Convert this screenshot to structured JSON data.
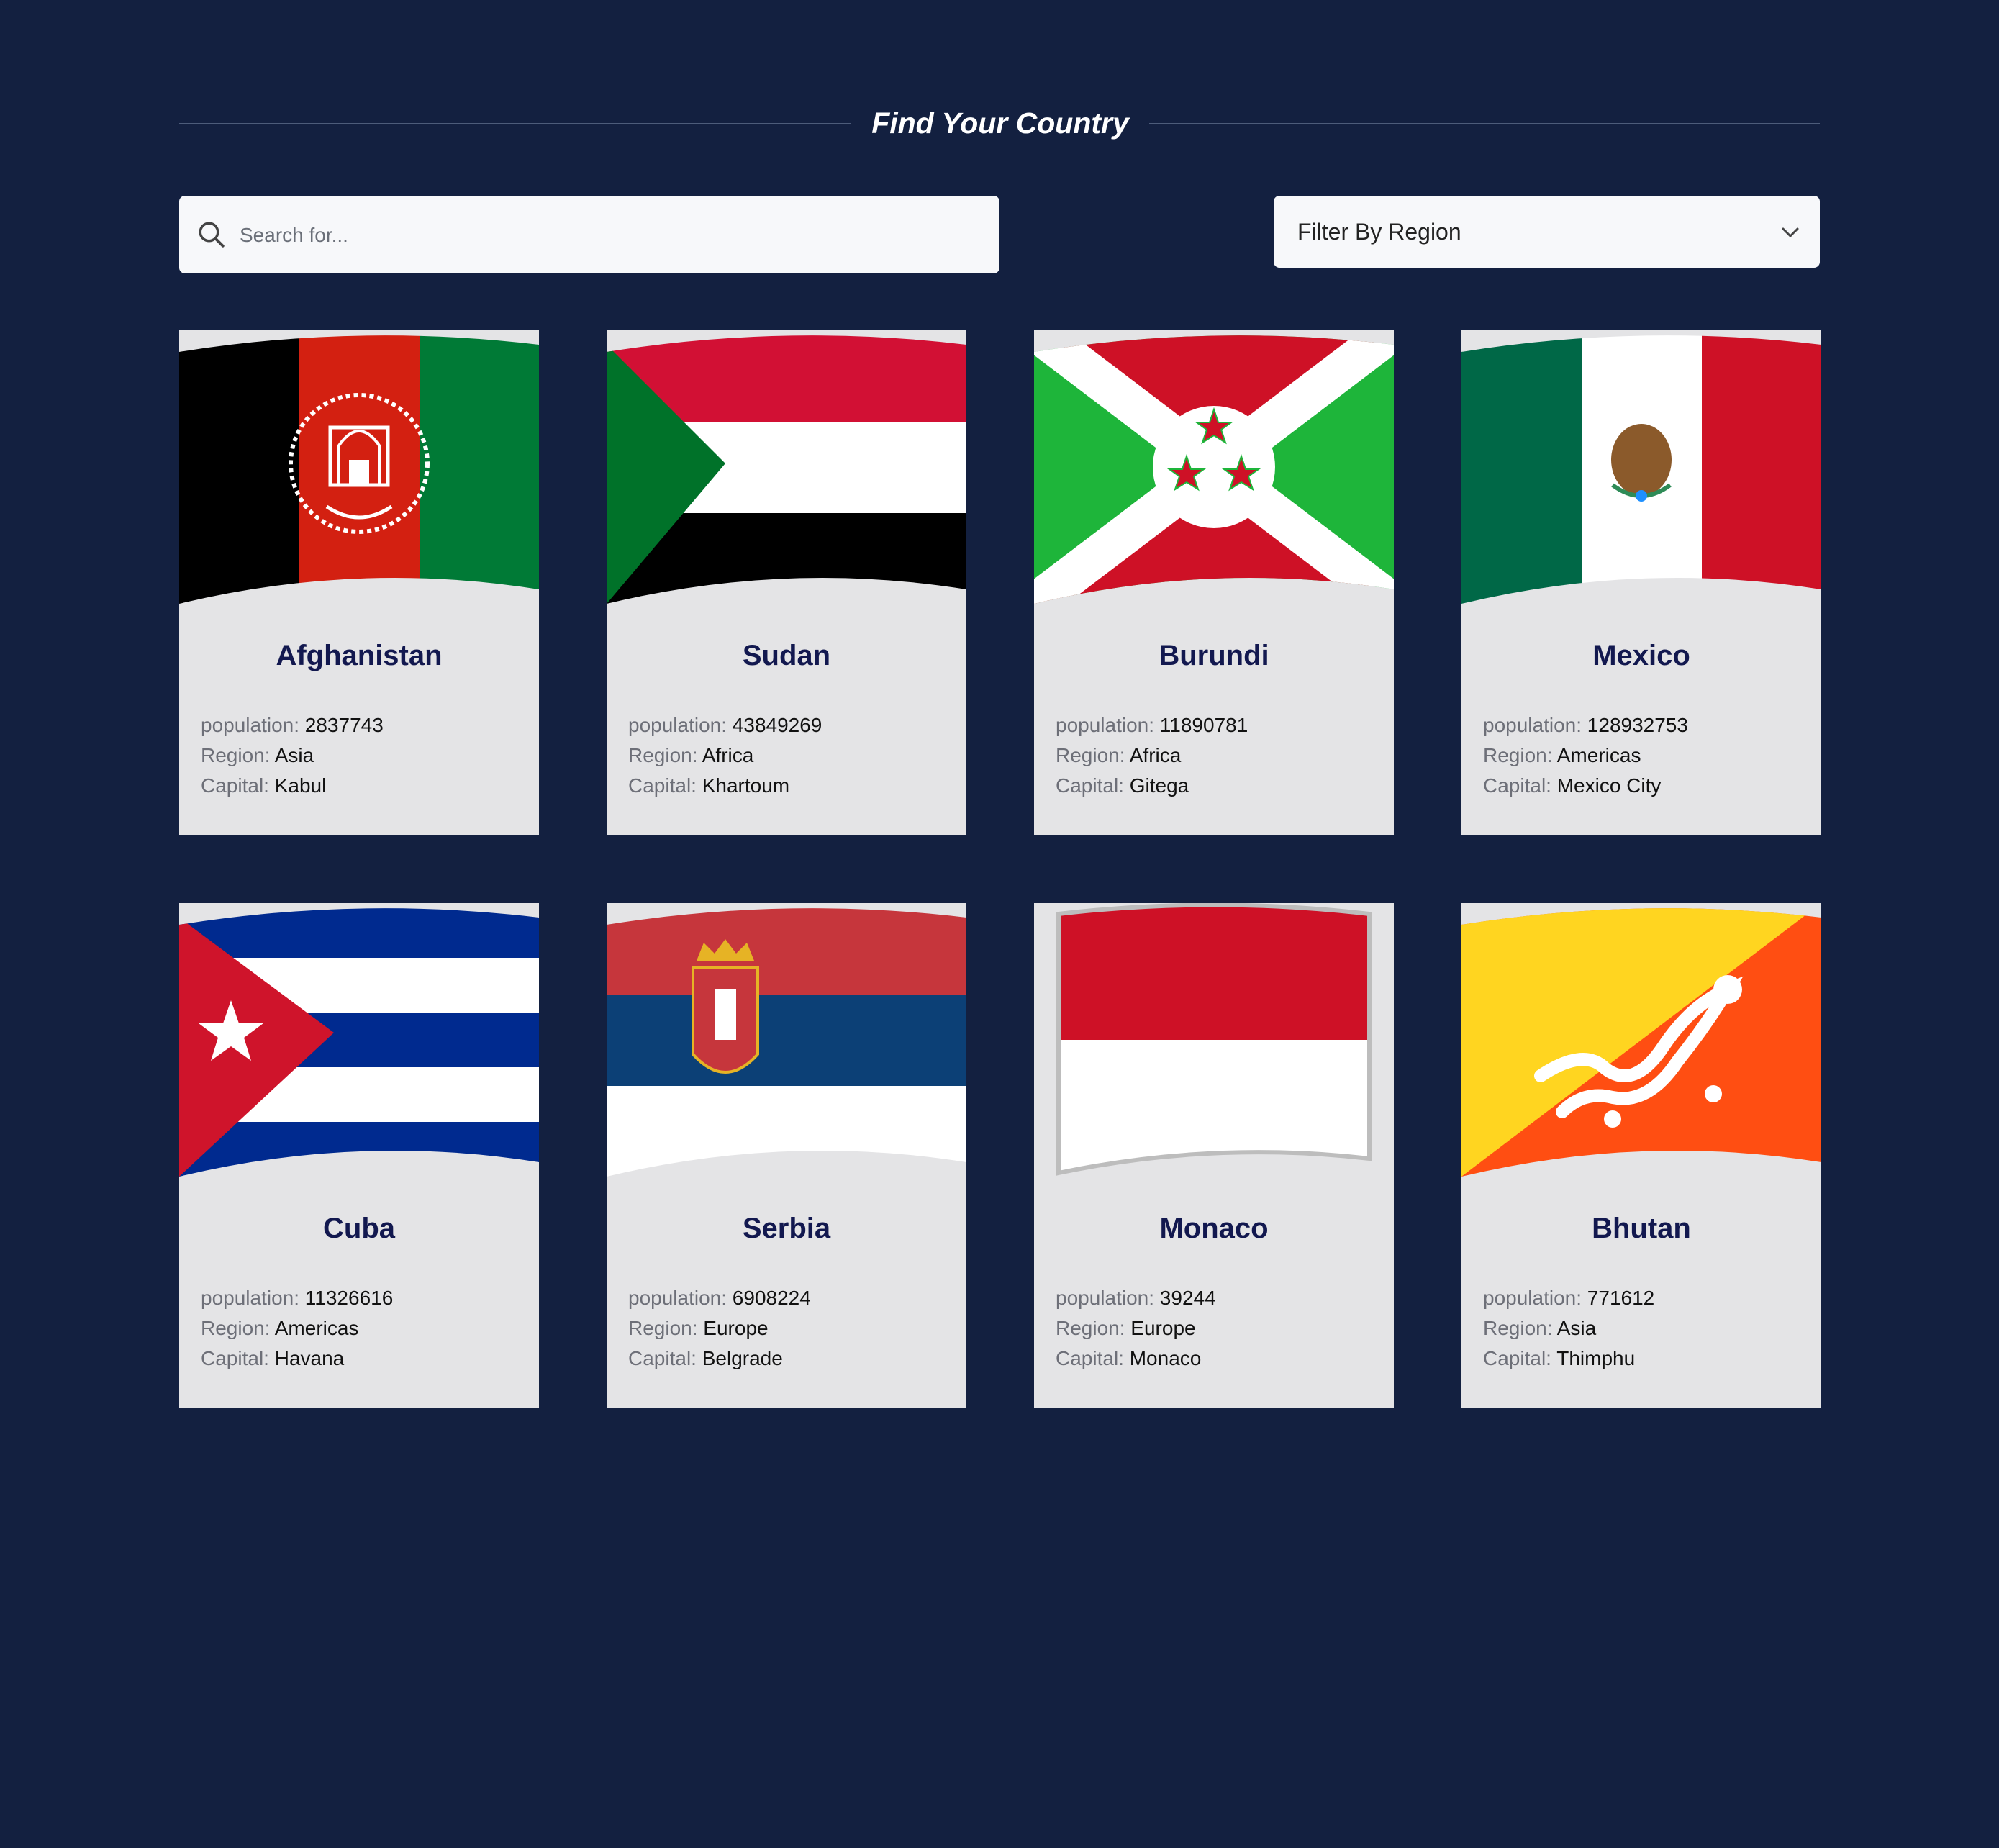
{
  "header": {
    "title": "Find Your Country"
  },
  "search": {
    "placeholder": "Search for..."
  },
  "filter": {
    "label": "Filter By Region"
  },
  "labels": {
    "population": "population:",
    "region": "Region:",
    "capital": "Capital:"
  },
  "countries": [
    {
      "name": "Afghanistan",
      "population": "2837743",
      "region": "Asia",
      "capital": "Kabul"
    },
    {
      "name": "Sudan",
      "population": "43849269",
      "region": "Africa",
      "capital": "Khartoum"
    },
    {
      "name": "Burundi",
      "population": "11890781",
      "region": "Africa",
      "capital": "Gitega"
    },
    {
      "name": "Mexico",
      "population": "128932753",
      "region": "Americas",
      "capital": "Mexico City"
    },
    {
      "name": "Cuba",
      "population": "11326616",
      "region": "Americas",
      "capital": "Havana"
    },
    {
      "name": "Serbia",
      "population": "6908224",
      "region": "Europe",
      "capital": "Belgrade"
    },
    {
      "name": "Monaco",
      "population": "39244",
      "region": "Europe",
      "capital": "Monaco"
    },
    {
      "name": "Bhutan",
      "population": "771612",
      "region": "Asia",
      "capital": "Thimphu"
    }
  ],
  "colors": {
    "background": "#132040",
    "card": "#e4e4e6",
    "country_name": "#12184f"
  }
}
